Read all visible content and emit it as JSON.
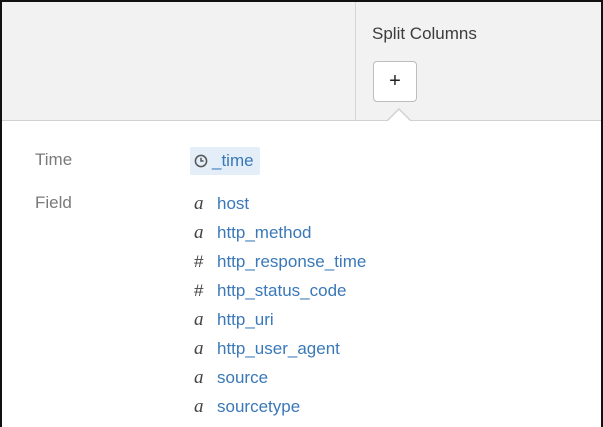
{
  "header": {
    "split_columns_label": "Split Columns",
    "add_button_label": "+"
  },
  "rows": {
    "time_label": "Time",
    "field_label": "Field"
  },
  "time_field": {
    "icon": "clock-icon",
    "name": "_time"
  },
  "fields": [
    {
      "type": "string",
      "icon": "a",
      "name": "host"
    },
    {
      "type": "string",
      "icon": "a",
      "name": "http_method"
    },
    {
      "type": "number",
      "icon": "#",
      "name": "http_response_time"
    },
    {
      "type": "number",
      "icon": "#",
      "name": "http_status_code"
    },
    {
      "type": "string",
      "icon": "a",
      "name": "http_uri"
    },
    {
      "type": "string",
      "icon": "a",
      "name": "http_user_agent"
    },
    {
      "type": "string",
      "icon": "a",
      "name": "source"
    },
    {
      "type": "string",
      "icon": "a",
      "name": "sourcetype"
    }
  ],
  "colors": {
    "link": "#3a78b8",
    "chip_background": "#e3eef9",
    "header_background": "#f2f2f2"
  }
}
